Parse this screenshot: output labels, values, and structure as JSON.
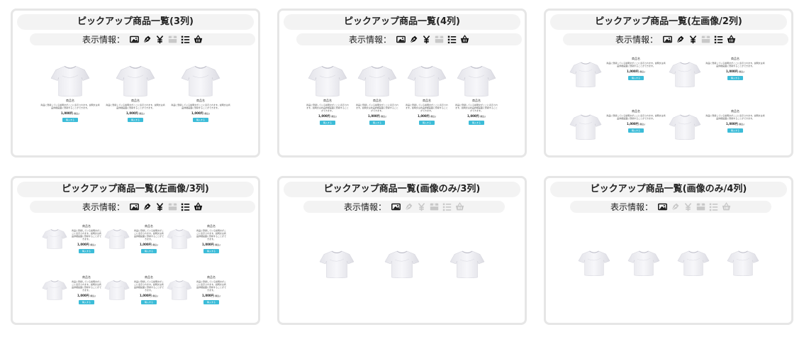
{
  "info_label": "表示情報：",
  "icons": [
    "image-icon",
    "pen-nib-icon",
    "yen-icon",
    "box-icon",
    "list-icon",
    "basket-icon"
  ],
  "product": {
    "name": "商品名",
    "description": "商品に登録している説明文がここに表示されます。説明文は商品詳細画面に登録することができます。",
    "price": "1,000円",
    "tax": "(税込)",
    "button": "購入する"
  },
  "colors": {
    "accent": "#3cbcd8",
    "border": "#e6e6e6",
    "bar": "#f3f3f3",
    "disabled": "#c8c8c8"
  },
  "cards": [
    {
      "title": "ピックアップ商品一覧(3列)",
      "layout": "grid",
      "columns": 3,
      "rows": 1,
      "icons_enabled": [
        true,
        true,
        true,
        false,
        true,
        true
      ],
      "show_text": true
    },
    {
      "title": "ピックアップ商品一覧(4列)",
      "layout": "grid",
      "columns": 4,
      "rows": 1,
      "icons_enabled": [
        true,
        true,
        true,
        false,
        true,
        true
      ],
      "show_text": true
    },
    {
      "title": "ピックアップ商品一覧(左画像/2列)",
      "layout": "side",
      "columns": 2,
      "rows": 2,
      "icons_enabled": [
        true,
        true,
        true,
        false,
        true,
        true
      ],
      "show_text": true
    },
    {
      "title": "ピックアップ商品一覧(左画像/3列)",
      "layout": "side",
      "columns": 3,
      "rows": 2,
      "icons_enabled": [
        true,
        true,
        true,
        false,
        true,
        true
      ],
      "show_text": true
    },
    {
      "title": "ピックアップ商品一覧(画像のみ/3列)",
      "layout": "grid",
      "columns": 3,
      "rows": 1,
      "icons_enabled": [
        true,
        false,
        false,
        false,
        false,
        false
      ],
      "show_text": false
    },
    {
      "title": "ピックアップ商品一覧(画像のみ/4列)",
      "layout": "grid",
      "columns": 4,
      "rows": 1,
      "icons_enabled": [
        true,
        false,
        false,
        false,
        false,
        false
      ],
      "show_text": false
    }
  ]
}
